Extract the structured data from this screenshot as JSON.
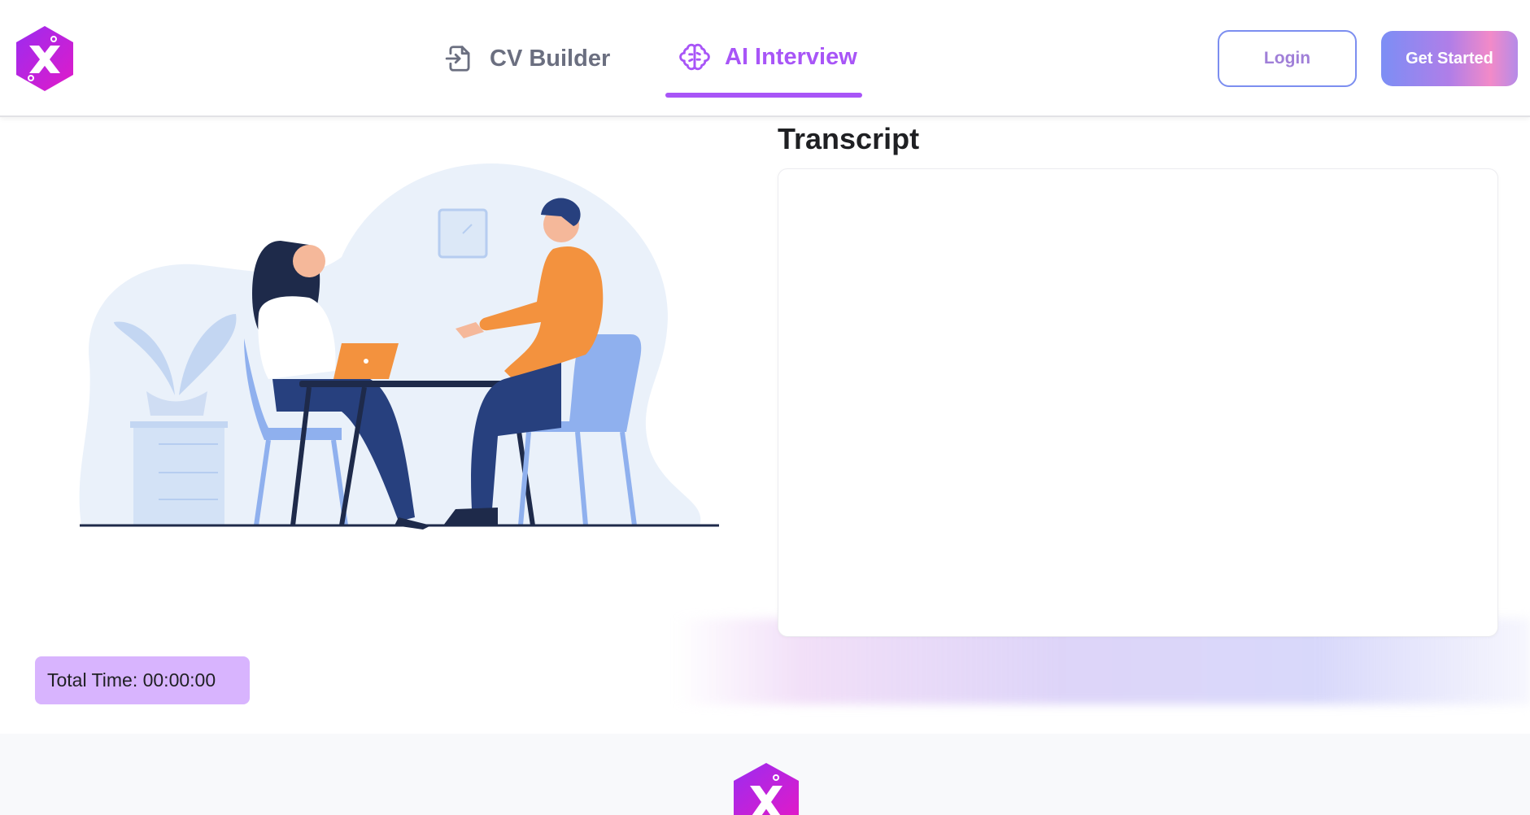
{
  "header": {
    "logo_alt": "X",
    "nav": [
      {
        "label": "CV Builder",
        "icon": "file-import-icon",
        "active": false
      },
      {
        "label": "AI Interview",
        "icon": "brain-icon",
        "active": true
      }
    ],
    "login_label": "Login",
    "get_started_label": "Get Started"
  },
  "main": {
    "transcript_title": "Transcript",
    "transcript_text": "",
    "timer_label": "Total Time: 00:00:00"
  },
  "colors": {
    "accent": "#a855f7",
    "timer_bg": "#d8b4fe",
    "logo_purple": "#a21caf"
  }
}
